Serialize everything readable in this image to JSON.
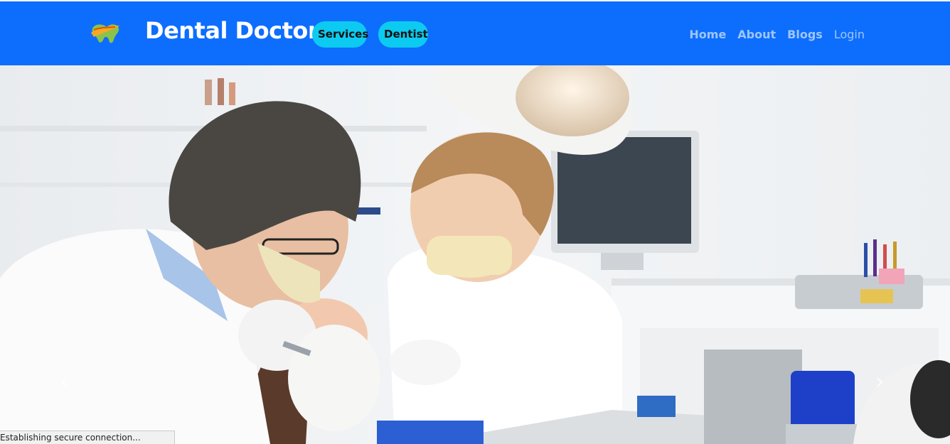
{
  "header": {
    "brand_title": "Dental Doctor",
    "logo_icon": "tooth-logo-icon",
    "pills": [
      {
        "label": "Services"
      },
      {
        "label": "Dentist"
      }
    ],
    "nav": [
      {
        "label": "Home"
      },
      {
        "label": "About"
      },
      {
        "label": "Blogs"
      },
      {
        "label": "Login"
      }
    ],
    "colors": {
      "navbar": "#0d6efd",
      "pill": "#0dcaf0"
    }
  },
  "hero": {
    "image_subject": "dentists-treating-patient-photo",
    "prev_icon": "chevron-left-icon",
    "next_icon": "chevron-right-icon",
    "prev_glyph": "‹",
    "next_glyph": "›"
  },
  "status_bar": {
    "text": "Establishing secure connection..."
  }
}
